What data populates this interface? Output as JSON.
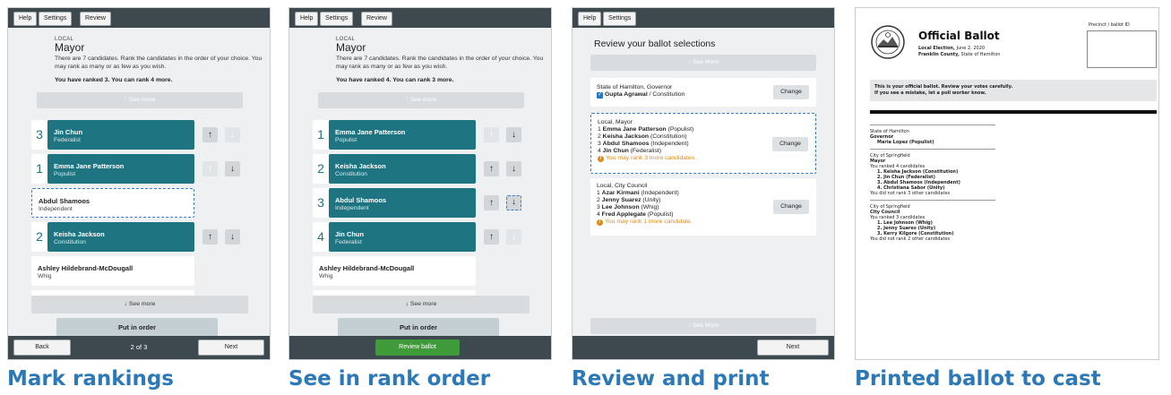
{
  "captions": [
    "Mark rankings",
    "See in rank order",
    "Review and print",
    "Printed ballot to cast"
  ],
  "toolbar": {
    "help": "Help",
    "settings": "Settings",
    "review": "Review"
  },
  "panel1": {
    "local": "LOCAL",
    "title": "Mayor",
    "instructions": "There are 7 candidates. Rank the candidates in the order of your choice. You may rank as many or as few as you wish.",
    "ranked": "You have ranked 3. You can rank 4 more.",
    "see_more_up": "↑ See more",
    "see_more_down": "↓ See more",
    "put_in_order": "Put in order",
    "back": "Back",
    "page": "2 of 3",
    "next": "Next",
    "candidates": [
      {
        "rank": "3",
        "name": "Jin Chun",
        "party": "Federalist"
      },
      {
        "rank": "1",
        "name": "Emma Jane Patterson",
        "party": "Populist"
      },
      {
        "rank": "",
        "name": "Abdul Shamoos",
        "party": "Independent"
      },
      {
        "rank": "2",
        "name": "Keisha Jackson",
        "party": "Constitution"
      },
      {
        "rank": "",
        "name": "Ashley Hildebrand-McDougall",
        "party": "Whig"
      }
    ]
  },
  "panel2": {
    "local": "LOCAL",
    "title": "Mayor",
    "instructions": "There are 7 candidates. Rank the candidates in the order of your choice. You may rank as many or as few as you wish.",
    "ranked": "You have ranked 4. You can rank 3 more.",
    "see_more_up": "↑ See more",
    "see_more_down": "↓ See more",
    "put_in_order": "Put in order",
    "review_ballot": "Review ballot",
    "candidates": [
      {
        "rank": "1",
        "name": "Emma Jane Patterson",
        "party": "Populist"
      },
      {
        "rank": "2",
        "name": "Keisha Jackson",
        "party": "Constitution"
      },
      {
        "rank": "3",
        "name": "Abdul Shamoos",
        "party": "Independent"
      },
      {
        "rank": "4",
        "name": "Jin Chun",
        "party": "Federalist"
      },
      {
        "rank": "",
        "name": "Ashley Hildebrand-McDougall",
        "party": "Whig"
      }
    ]
  },
  "panel3": {
    "title": "Review your ballot selections",
    "see_more_up": "↑ See More",
    "see_more_down": "↓ See More",
    "next": "Next",
    "change": "Change",
    "governor": {
      "heading": "State of Hamilton, Governor",
      "name": "Gupta Agrawal",
      "party": " / Constitution"
    },
    "mayor": {
      "heading": "Local, Mayor",
      "rows": [
        {
          "n": "1",
          "name": "Emma Jane Patterson",
          "party": " (Populist)"
        },
        {
          "n": "2",
          "name": "Keisha Jackson",
          "party": " (Constitution)"
        },
        {
          "n": "3",
          "name": "Abdul Shamoos",
          "party": " (Independent)"
        },
        {
          "n": "4",
          "name": "Jin Chun",
          "party": " (Federalist)"
        }
      ],
      "warning": "You may rank 3 more candidates."
    },
    "council": {
      "heading": "Local, City Council",
      "rows": [
        {
          "n": "1",
          "name": "Azar Kirmani",
          "party": " (Independent)"
        },
        {
          "n": "2",
          "name": "Jenny Suarez",
          "party": " (Unity)"
        },
        {
          "n": "3",
          "name": "Lee Johnson",
          "party": " (Whig)"
        },
        {
          "n": "4",
          "name": "Fred Applegate",
          "party": " (Populist)"
        }
      ],
      "warning": "You may rank 1 more candidate."
    }
  },
  "ballot": {
    "title": "Official Ballot",
    "election_bold": "Local Election,",
    "election_rest": " June 2, 2020",
    "county_bold": "Franklin County,",
    "county_rest": " State of Hamilton",
    "precinct": "Precinct / ballot ID",
    "notice1": "This is your official ballot. Review your votes carefully.",
    "notice2": "If you see a mistake, let a poll worker know.",
    "gov_state": "State of Hamilton",
    "gov_office": "Governor",
    "gov_choice": "Maria Lopez (Populist)",
    "mayor_city": "City of Springfield",
    "mayor_office": "Mayor",
    "mayor_ranked": "You ranked 4 candidates",
    "mayor_list": [
      "1.  Keisha Jackson (Constitution)",
      "2.  Jin Chun (Federalist)",
      "3.  Abdul Shamoos (Independent)",
      "4.  Christiana Sabor (Unity)"
    ],
    "mayor_unranked": "You did not rank 3 other candidates",
    "council_city": "City of Springfield",
    "council_office": "City Council",
    "council_ranked": "You ranked 3 candidates",
    "council_list": [
      "1.  Lee Johnson (Whig)",
      "2.  Jenny Suares (Unity)",
      "3.  Kerry Kilgore (Constitution)"
    ],
    "council_unranked": "You did not rank 2 other candidates"
  }
}
